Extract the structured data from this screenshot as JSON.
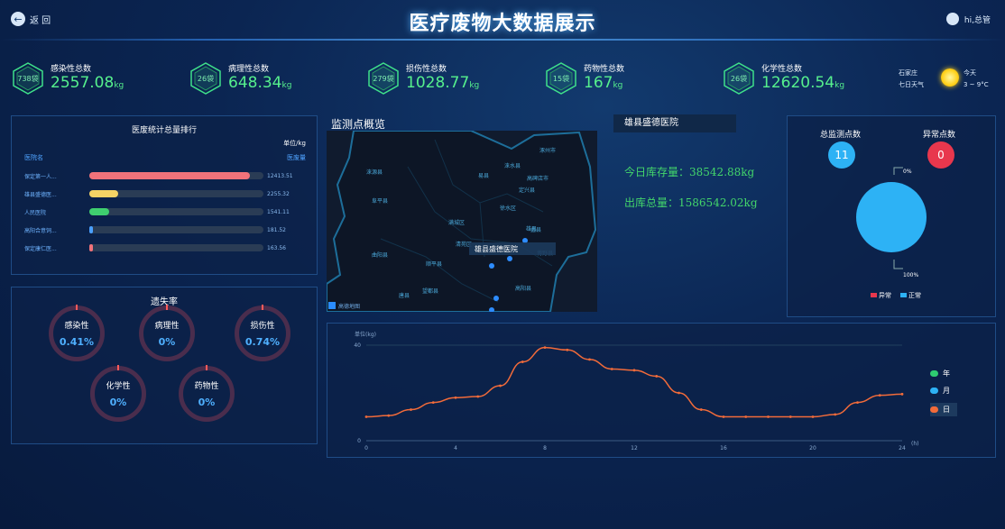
{
  "header": {
    "back_label": "返 回",
    "title": "医疗废物大数据展示",
    "user_label": "hi,总管"
  },
  "stats": [
    {
      "count": "738袋",
      "label": "感染性总数",
      "value": "2557.08",
      "unit": "kg"
    },
    {
      "count": "26袋",
      "label": "病理性总数",
      "value": "648.34",
      "unit": "kg"
    },
    {
      "count": "279袋",
      "label": "损伤性总数",
      "value": "1028.77",
      "unit": "kg"
    },
    {
      "count": "15袋",
      "label": "药物性总数",
      "value": "167",
      "unit": "kg"
    },
    {
      "count": "26袋",
      "label": "化学性总数",
      "value": "12620.54",
      "unit": "kg"
    }
  ],
  "weather": {
    "location": "石家庄",
    "forecast_label": "七日天气",
    "day": "今天",
    "temp": "3 ~ 9°C"
  },
  "ranking": {
    "title": "医废统计总量排行",
    "unit": "单位/kg",
    "col_name": "医院名",
    "col_value": "医废量",
    "max": 12413.51,
    "items": [
      {
        "name": "保定第一人...",
        "value": 12413.51,
        "value_text": "12413.51",
        "color": "#f0727a"
      },
      {
        "name": "雄县盛德医...",
        "value": 2255.32,
        "value_text": "2255.32",
        "color": "#f5d365"
      },
      {
        "name": "人民医院",
        "value": 1541.11,
        "value_text": "1541.11",
        "color": "#3fcf6f"
      },
      {
        "name": "高阳合意饲...",
        "value": 181.52,
        "value_text": "181.52",
        "color": "#4a9fff"
      },
      {
        "name": "保定康仁医...",
        "value": 163.56,
        "value_text": "163.56",
        "color": "#f0727a"
      }
    ]
  },
  "loss_rate": {
    "title": "遗失率",
    "items": [
      {
        "label": "感染性",
        "value": "0.41%"
      },
      {
        "label": "病理性",
        "value": "0%"
      },
      {
        "label": "损伤性",
        "value": "0.74%"
      },
      {
        "label": "化学性",
        "value": "0%"
      },
      {
        "label": "药物性",
        "value": "0%"
      }
    ]
  },
  "map": {
    "title": "监测点概览",
    "popup": "雄县盛德医院",
    "attribution": "高德地图",
    "places": [
      "涞源县",
      "易县",
      "涞水县",
      "涿州市",
      "高碑店市",
      "定兴县",
      "徐水区",
      "雄县",
      "满城区",
      "清苑区",
      "顺平县",
      "望都县",
      "蠡县",
      "博野县",
      "高阳县",
      "唐县",
      "曲阳县",
      "阜平县"
    ]
  },
  "hospital": {
    "name": "雄县盛德医院",
    "stock_label": "今日库存量：",
    "stock_value": "38542.88kg",
    "out_label": "出库总量：",
    "out_value": "1586542.02kg"
  },
  "monitor": {
    "total_label": "总监测点数",
    "total_value": "11",
    "abnormal_label": "异常点数",
    "abnormal_value": "0",
    "pie_top": "0%",
    "pie_bottom": "100%",
    "legend": [
      {
        "label": "异常",
        "color": "#e8374d"
      },
      {
        "label": "正常",
        "color": "#2db2f5"
      }
    ]
  },
  "chart_data": {
    "type": "line",
    "ylabel": "单位(kg)",
    "xlabel": "(h)",
    "ylim": [
      0,
      40
    ],
    "xlim": [
      0,
      24
    ],
    "yticks": [
      0,
      40
    ],
    "xticks": [
      0,
      4,
      8,
      12,
      16,
      20,
      24
    ],
    "legend": [
      {
        "label": "年",
        "color": "#2ecc71"
      },
      {
        "label": "月",
        "color": "#2db2f5"
      },
      {
        "label": "日",
        "color": "#f26b3a"
      }
    ],
    "series": [
      {
        "name": "日",
        "color": "#f26b3a",
        "x": [
          0,
          1,
          2,
          3,
          4,
          5,
          6,
          7,
          8,
          9,
          10,
          11,
          12,
          13,
          14,
          15,
          16,
          17,
          18,
          19,
          20,
          21,
          22,
          23,
          24
        ],
        "values": [
          10,
          10.5,
          13,
          16,
          18,
          18.5,
          23,
          33,
          39,
          38,
          34,
          30,
          29.5,
          27,
          20,
          13,
          10,
          10,
          10,
          10,
          10,
          11,
          16,
          19,
          19.5
        ]
      }
    ]
  }
}
